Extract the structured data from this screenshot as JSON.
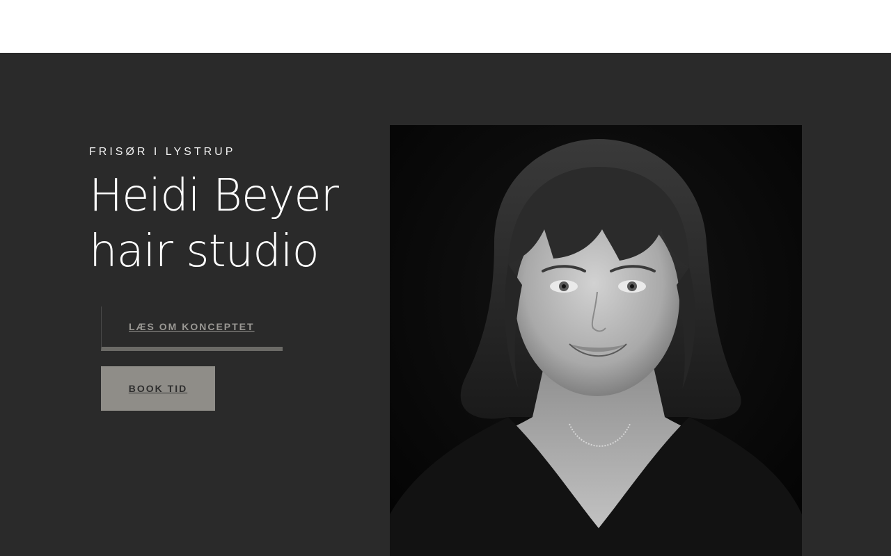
{
  "header": {},
  "hero": {
    "eyebrow": "FRISØR I LYSTRUP",
    "title_line1": "Heidi Beyer",
    "title_line2": "hair studio",
    "buttons": {
      "concept_label": "LÆS OM KONCEPTET",
      "book_label": "BOOK TID"
    },
    "photo": {
      "alt": "Portrait of Heidi Beyer"
    }
  },
  "colors": {
    "hero_background": "#2a2a2a",
    "book_button_bg": "#8f8d88",
    "concept_underline": "#6b6a66",
    "text_white": "#ffffff"
  }
}
